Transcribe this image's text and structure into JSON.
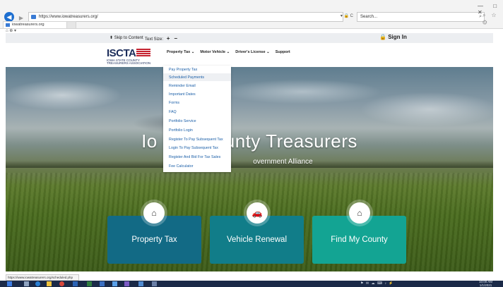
{
  "browser": {
    "url": "https://www.iowatreasurers.org/",
    "tab_title": "iowatreasurers.org",
    "search_placeholder": "Search...",
    "address_tools": "▾ 🔒 C",
    "window_controls": "— □ ✕",
    "toolbar_icons": "⌕ ☆ ⚙",
    "favorites_text": "⌂ ⊕ ▾"
  },
  "topbar": {
    "skip_label": "Skip to Content",
    "text_size_label": "Text Size:",
    "plus": "+",
    "minus": "−",
    "sign_in": "Sign In"
  },
  "logo": {
    "acronym": "ISCTA",
    "tagline_1": "IOWA STATE COUNTY",
    "tagline_2": "TREASURERS ASSOCIATION"
  },
  "nav": {
    "items": [
      {
        "label": "Property Tax"
      },
      {
        "label": "Motor Vehicle"
      },
      {
        "label": "Driver's License"
      },
      {
        "label": "Support"
      }
    ]
  },
  "dropdown": {
    "items": [
      "Pay Property Tax",
      "Scheduled Payments",
      "Reminder Email",
      "Important Dates",
      "Forms",
      "FAQ",
      "Portfolio Service",
      "Portfolio Login",
      "Register To Pay Subsequent Tax",
      "Login To Pay Subsequent Tax",
      "Register And Bid For Tax Sales",
      "Fee Calculator"
    ],
    "highlighted_index": 1
  },
  "hero": {
    "title_left": "Io",
    "title_right": "unty Treasurers",
    "subtitle": "overnment Alliance"
  },
  "tiles": [
    {
      "label": "Property Tax",
      "icon": "home-icon",
      "color": "#126a85"
    },
    {
      "label": "Vehicle Renewal",
      "icon": "car-icon",
      "color": "#117d89"
    },
    {
      "label": "Find My County",
      "icon": "home-icon",
      "color": "#13a493"
    }
  ],
  "status_bar": {
    "text": "https://www.iowatreasurers.org/scheduled.php"
  },
  "taskbar": {
    "tray_text": "⚑ ✉ ☁ ⌨ ♪ ⚡",
    "time": "10:00 AM",
    "date": "1/1/2021"
  }
}
